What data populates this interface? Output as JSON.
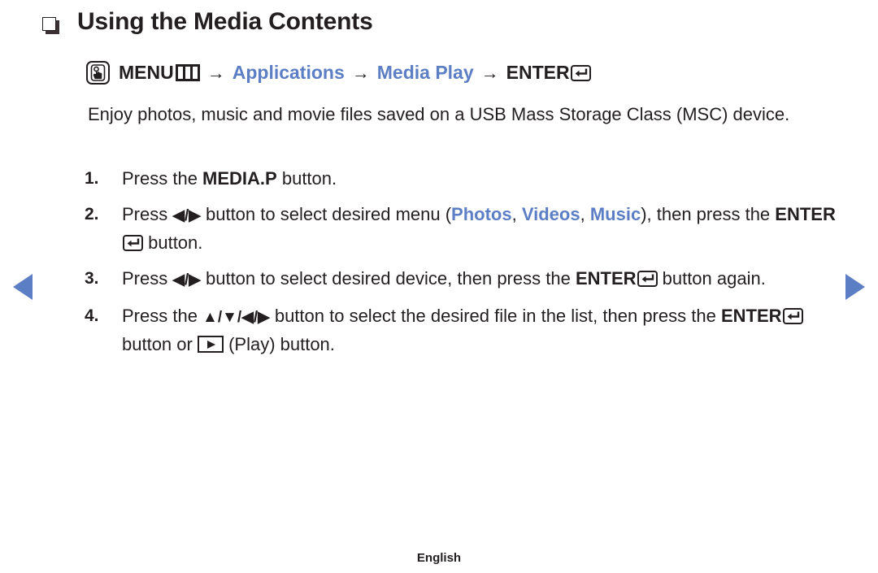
{
  "page": {
    "title": "Using the Media Contents",
    "bullet_icon": "square-bullet-icon",
    "footer_language": "English"
  },
  "nav": {
    "prev_icon": "triangle-left-icon",
    "next_icon": "triangle-right-icon",
    "arrow_color": "#5b7ec4"
  },
  "menu_path": {
    "hand_icon": "hand-press-icon",
    "menu_label": "MENU",
    "menu_icon": "menu-grid-icon",
    "arrow_1": "→",
    "step_applications": "Applications",
    "arrow_2": "→",
    "step_media_play": "Media Play",
    "arrow_3": "→",
    "enter_label": "ENTER",
    "enter_icon": "enter-return-icon",
    "accent_color": "#5b7ec4"
  },
  "intro": {
    "text": "Enjoy photos, music and movie files saved on a USB Mass Storage Class (MSC) device."
  },
  "steps": [
    {
      "number": "1.",
      "text_before": "Press the ",
      "bold_1": "MEDIA.P",
      "text_after": " button."
    },
    {
      "number": "2.",
      "text_before": "Press ",
      "dpad": "◀/▶",
      "text_mid": " button to select desired menu (",
      "menu_photos": "Photos",
      "sep_1": ", ",
      "menu_videos": "Videos",
      "sep_2": ", ",
      "menu_music": "Music",
      "text_after": "), then press the ",
      "enter_label": "ENTER",
      "enter_icon": "enter-return-icon",
      "text_end": " button."
    },
    {
      "number": "3.",
      "text_before": "Press ",
      "dpad": "◀/▶",
      "text_mid": " button to select desired device, then press the ",
      "enter_label": "ENTER",
      "enter_icon": "enter-return-icon",
      "text_after": " button again."
    },
    {
      "number": "4.",
      "text_before": "Press the ",
      "dpad": "▲/▼/◀/▶",
      "text_mid": " button to select the desired file in the list, then press the ",
      "enter_label": "ENTER",
      "enter_icon": "enter-return-icon",
      "text_after": " button or ",
      "play_icon": "play-button-icon",
      "text_end": " (Play) button."
    }
  ]
}
